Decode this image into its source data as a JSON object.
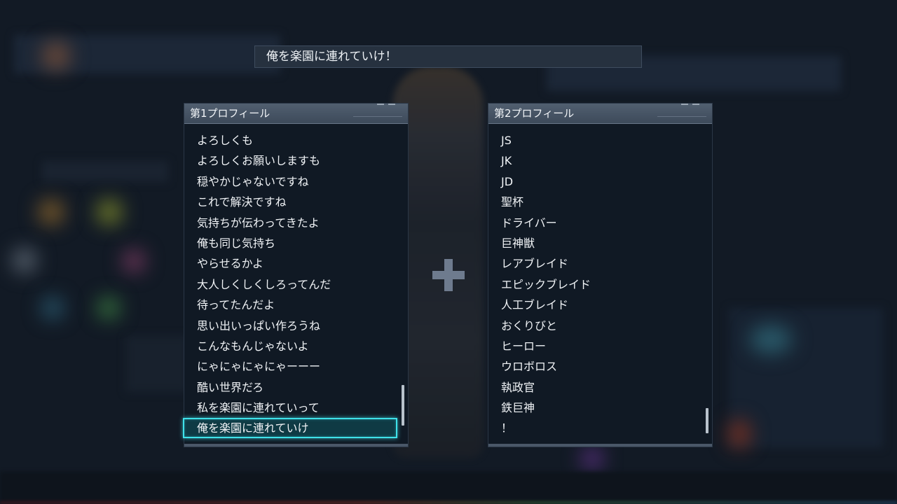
{
  "title": "俺を楽園に連れていけ！",
  "profile1": {
    "header": "第1プロフィール",
    "items": [
      "よろしくも",
      "よろしくお願いしますも",
      "穏やかじゃないですね",
      "これで解決ですね",
      "気持ちが伝わってきたよ",
      "俺も同じ気持ち",
      "やらせるかよ",
      "大人しくしくしろってんだ",
      "待ってたんだよ",
      "思い出いっぱい作ろうね",
      "こんなもんじゃないよ",
      "にゃにゃにゃにゃーーー",
      "酷い世界だろ",
      "私を楽園に連れていって",
      "俺を楽園に連れていけ"
    ],
    "selected_index": 14
  },
  "plus_symbol": "plus-icon",
  "profile2": {
    "header": "第2プロフィール",
    "items": [
      "JS",
      "JK",
      "JD",
      "聖杯",
      "ドライバー",
      "巨神獣",
      "レアブレイド",
      "エピックブレイド",
      "人工ブレイド",
      "おくりびと",
      "ヒーロー",
      "ウロボロス",
      "執政官",
      "鉄巨神",
      "！"
    ]
  },
  "colors": {
    "accent": "#3fe2ea",
    "panel_header": "#4a5868",
    "background": "#121a25"
  }
}
